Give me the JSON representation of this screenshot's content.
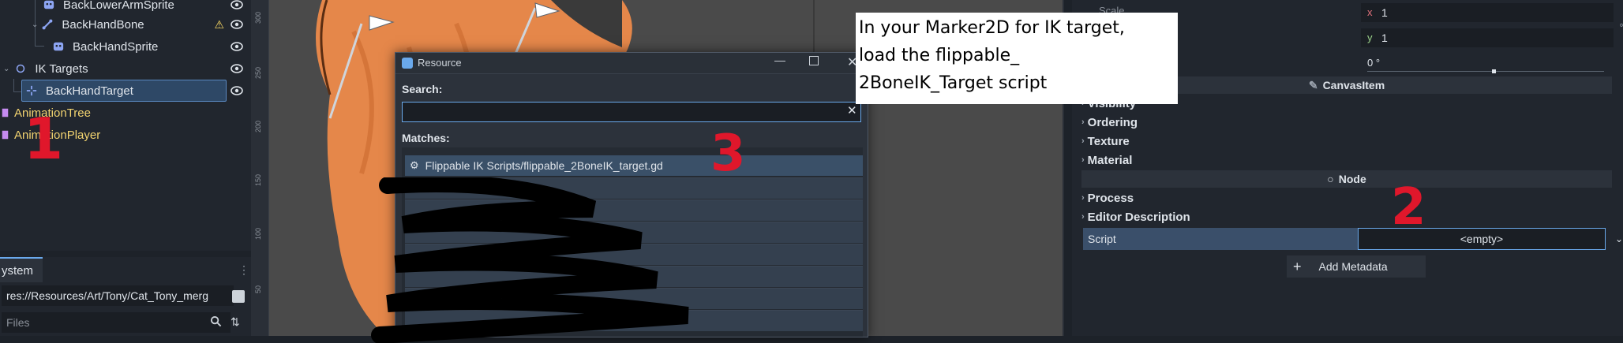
{
  "scene_tree": {
    "items": [
      {
        "label": "BackLowerArmSprite",
        "type": "sprite"
      },
      {
        "label": "BackHandBone",
        "type": "bone",
        "warning": true
      },
      {
        "label": "BackHandSprite",
        "type": "sprite"
      },
      {
        "label": "IK Targets",
        "type": "node"
      },
      {
        "label": "BackHandTarget",
        "type": "marker",
        "selected": true
      },
      {
        "label": "AnimationTree",
        "type": "animtree"
      },
      {
        "label": "AnimationPlayer",
        "type": "animplayer"
      }
    ]
  },
  "filesystem": {
    "tab_label": "ystem",
    "path_value": "res://Resources/Art/Tony/Cat_Tony_merg",
    "filter_placeholder": "Files"
  },
  "ruler": {
    "ticks": [
      "300",
      "250",
      "200",
      "150",
      "100",
      "50"
    ]
  },
  "dialog": {
    "title": "Resource",
    "search_label": "Search:",
    "search_value": "",
    "matches_label": "Matches:",
    "first_match": "Flippable IK Scripts/flippable_2BoneIK_target.gd"
  },
  "inspector": {
    "scale_label": "Scale",
    "scale_x_label": "x",
    "scale_x_value": "1",
    "scale_y_label": "y",
    "scale_y_value": "1",
    "rotation_value": "0 °",
    "canvasitem_header": "CanvasItem",
    "visibility_label": "Visibility",
    "ordering_label": "Ordering",
    "texture_label": "Texture",
    "material_label": "Material",
    "node_header": "Node",
    "process_label": "Process",
    "editor_description_label": "Editor Description",
    "script_label": "Script",
    "script_value": "<empty>",
    "add_metadata_label": "Add Metadata"
  },
  "annotation": {
    "text_line1": "In your Marker2D for IK target,",
    "text_line2": "load the flippable_",
    "text_line3": "2BoneIK_Target script",
    "step1": "1",
    "step2": "2",
    "step3": "3"
  },
  "colors": {
    "accent": "#6aa9ec",
    "annotation_red": "#e0172b",
    "selected_bg": "#2e4866"
  }
}
